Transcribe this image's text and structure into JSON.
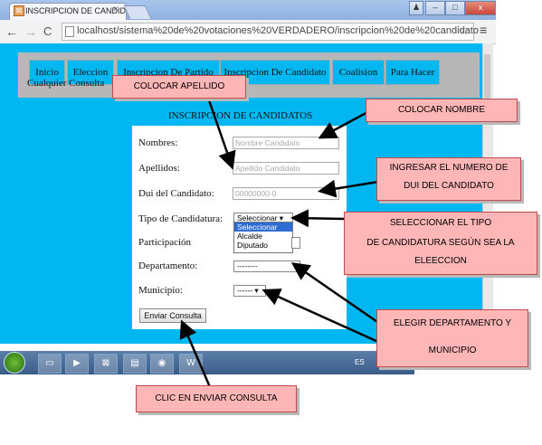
{
  "browser": {
    "tab_title": "INSCRIPCION DE CANDID",
    "tab_close": "×",
    "url": "localhost/sistema%20de%20votaciones%20VERDADERO/inscripcion%20de%20candidato",
    "back": "←",
    "forward": "→",
    "reload": "C",
    "star": "☆",
    "menu": "≡",
    "window_min": "–",
    "window_max": "□",
    "window_close": "x"
  },
  "nav": {
    "tabs": [
      "Inicio",
      "Eleccion",
      "Inscripcion De Partido",
      "Inscripcion De Candidato",
      "Coalision",
      "Para Hacer"
    ],
    "extra": "Cualquier Consulta"
  },
  "form": {
    "title": "INSCRIPCION DE CANDIDATOS",
    "nombres_label": "Nombres:",
    "nombres_placeholder": "Nombre Candidato",
    "apellidos_label": "Apellidos:",
    "apellidos_placeholder": "Apellido Candidato",
    "dui_label": "Dui del Candidato:",
    "dui_placeholder": "00000000-0",
    "tipo_label": "Tipo de Candidatura:",
    "tipo_selected": "Seleccionar ▾",
    "tipo_options": [
      "Seleccionar",
      "Alcalde",
      "Diputado"
    ],
    "participacion_label": "Participación",
    "departamento_label": "Departamento:",
    "departamento_selected": "--------",
    "municipio_label": "Municipio:",
    "municipio_selected": "------ ▾",
    "submit": "Enviar Consulta"
  },
  "taskbar": {
    "lang": "ES"
  },
  "callouts": {
    "apellido": "COLOCAR APELLIDO",
    "nombre": "COLOCAR NOMBRE",
    "dui_1": "INGRESAR EL NUMERO DE",
    "dui_2": "DUI DEL CANDIDATO",
    "tipo_1": "SELECCIONAR EL TIPO",
    "tipo_2": "DE CANDIDATURA SEGÚN SEA LA",
    "tipo_3": "ELEECCION",
    "depto_1": "ELEGIR DEPARTAMENTO Y",
    "depto_2": "MUNICIPIO",
    "enviar": "CLIC EN ENVIAR CONSULTA"
  }
}
